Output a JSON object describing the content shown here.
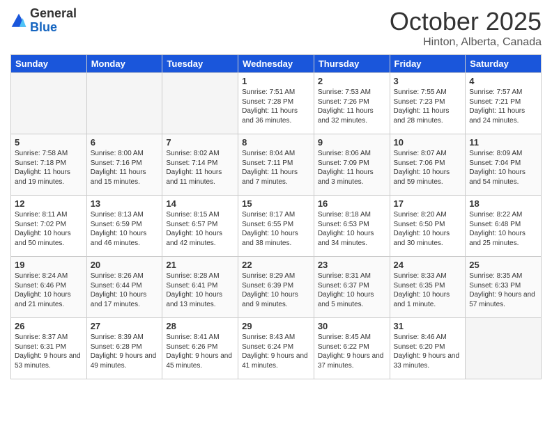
{
  "header": {
    "logo_general": "General",
    "logo_blue": "Blue",
    "month": "October 2025",
    "location": "Hinton, Alberta, Canada"
  },
  "days_of_week": [
    "Sunday",
    "Monday",
    "Tuesday",
    "Wednesday",
    "Thursday",
    "Friday",
    "Saturday"
  ],
  "weeks": [
    [
      {
        "day": "",
        "empty": true
      },
      {
        "day": "",
        "empty": true
      },
      {
        "day": "",
        "empty": true
      },
      {
        "day": "1",
        "sunrise": "7:51 AM",
        "sunset": "7:28 PM",
        "daylight": "11 hours and 36 minutes."
      },
      {
        "day": "2",
        "sunrise": "7:53 AM",
        "sunset": "7:26 PM",
        "daylight": "11 hours and 32 minutes."
      },
      {
        "day": "3",
        "sunrise": "7:55 AM",
        "sunset": "7:23 PM",
        "daylight": "11 hours and 28 minutes."
      },
      {
        "day": "4",
        "sunrise": "7:57 AM",
        "sunset": "7:21 PM",
        "daylight": "11 hours and 24 minutes."
      }
    ],
    [
      {
        "day": "5",
        "sunrise": "7:58 AM",
        "sunset": "7:18 PM",
        "daylight": "11 hours and 19 minutes."
      },
      {
        "day": "6",
        "sunrise": "8:00 AM",
        "sunset": "7:16 PM",
        "daylight": "11 hours and 15 minutes."
      },
      {
        "day": "7",
        "sunrise": "8:02 AM",
        "sunset": "7:14 PM",
        "daylight": "11 hours and 11 minutes."
      },
      {
        "day": "8",
        "sunrise": "8:04 AM",
        "sunset": "7:11 PM",
        "daylight": "11 hours and 7 minutes."
      },
      {
        "day": "9",
        "sunrise": "8:06 AM",
        "sunset": "7:09 PM",
        "daylight": "11 hours and 3 minutes."
      },
      {
        "day": "10",
        "sunrise": "8:07 AM",
        "sunset": "7:06 PM",
        "daylight": "10 hours and 59 minutes."
      },
      {
        "day": "11",
        "sunrise": "8:09 AM",
        "sunset": "7:04 PM",
        "daylight": "10 hours and 54 minutes."
      }
    ],
    [
      {
        "day": "12",
        "sunrise": "8:11 AM",
        "sunset": "7:02 PM",
        "daylight": "10 hours and 50 minutes."
      },
      {
        "day": "13",
        "sunrise": "8:13 AM",
        "sunset": "6:59 PM",
        "daylight": "10 hours and 46 minutes."
      },
      {
        "day": "14",
        "sunrise": "8:15 AM",
        "sunset": "6:57 PM",
        "daylight": "10 hours and 42 minutes."
      },
      {
        "day": "15",
        "sunrise": "8:17 AM",
        "sunset": "6:55 PM",
        "daylight": "10 hours and 38 minutes."
      },
      {
        "day": "16",
        "sunrise": "8:18 AM",
        "sunset": "6:53 PM",
        "daylight": "10 hours and 34 minutes."
      },
      {
        "day": "17",
        "sunrise": "8:20 AM",
        "sunset": "6:50 PM",
        "daylight": "10 hours and 30 minutes."
      },
      {
        "day": "18",
        "sunrise": "8:22 AM",
        "sunset": "6:48 PM",
        "daylight": "10 hours and 25 minutes."
      }
    ],
    [
      {
        "day": "19",
        "sunrise": "8:24 AM",
        "sunset": "6:46 PM",
        "daylight": "10 hours and 21 minutes."
      },
      {
        "day": "20",
        "sunrise": "8:26 AM",
        "sunset": "6:44 PM",
        "daylight": "10 hours and 17 minutes."
      },
      {
        "day": "21",
        "sunrise": "8:28 AM",
        "sunset": "6:41 PM",
        "daylight": "10 hours and 13 minutes."
      },
      {
        "day": "22",
        "sunrise": "8:29 AM",
        "sunset": "6:39 PM",
        "daylight": "10 hours and 9 minutes."
      },
      {
        "day": "23",
        "sunrise": "8:31 AM",
        "sunset": "6:37 PM",
        "daylight": "10 hours and 5 minutes."
      },
      {
        "day": "24",
        "sunrise": "8:33 AM",
        "sunset": "6:35 PM",
        "daylight": "10 hours and 1 minute."
      },
      {
        "day": "25",
        "sunrise": "8:35 AM",
        "sunset": "6:33 PM",
        "daylight": "9 hours and 57 minutes."
      }
    ],
    [
      {
        "day": "26",
        "sunrise": "8:37 AM",
        "sunset": "6:31 PM",
        "daylight": "9 hours and 53 minutes."
      },
      {
        "day": "27",
        "sunrise": "8:39 AM",
        "sunset": "6:28 PM",
        "daylight": "9 hours and 49 minutes."
      },
      {
        "day": "28",
        "sunrise": "8:41 AM",
        "sunset": "6:26 PM",
        "daylight": "9 hours and 45 minutes."
      },
      {
        "day": "29",
        "sunrise": "8:43 AM",
        "sunset": "6:24 PM",
        "daylight": "9 hours and 41 minutes."
      },
      {
        "day": "30",
        "sunrise": "8:45 AM",
        "sunset": "6:22 PM",
        "daylight": "9 hours and 37 minutes."
      },
      {
        "day": "31",
        "sunrise": "8:46 AM",
        "sunset": "6:20 PM",
        "daylight": "9 hours and 33 minutes."
      },
      {
        "day": "",
        "empty": true
      }
    ]
  ]
}
